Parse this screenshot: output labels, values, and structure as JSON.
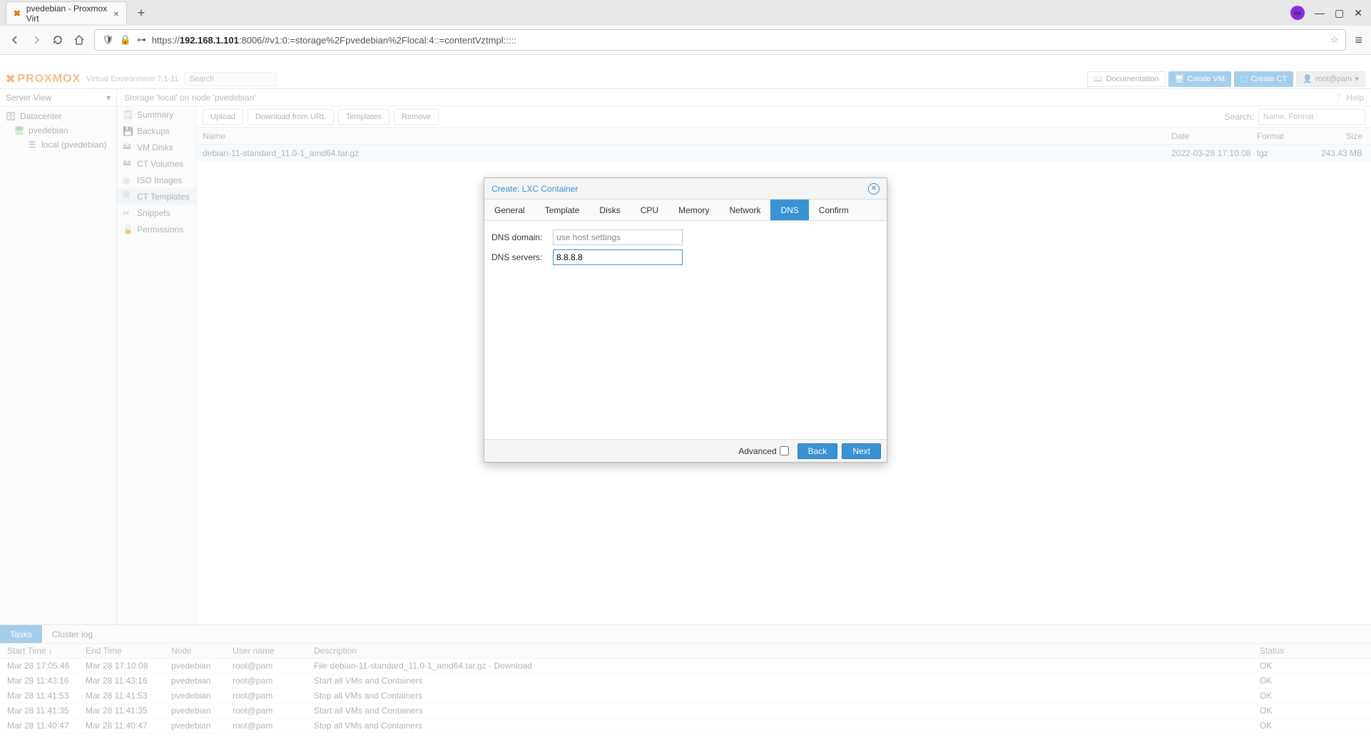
{
  "browser": {
    "tab_title": "pvedebian - Proxmox Virt",
    "url_prefix": "https://",
    "url_host": "192.168.1.101",
    "url_rest": ":8006/#v1:0:=storage%2Fpvedebian%2Flocal:4::=contentVztmpl:::::"
  },
  "header": {
    "logo": "PROXMOX",
    "version": "Virtual Environment 7.1-11",
    "search_placeholder": "Search",
    "doc": "Documentation",
    "create_vm": "Create VM",
    "create_ct": "Create CT",
    "user": "root@pam"
  },
  "tree": {
    "title": "Server View",
    "datacenter": "Datacenter",
    "node": "pvedebian",
    "storage": "local (pvedebian)"
  },
  "crumb": "Storage 'local' on node 'pvedebian'",
  "help": "Help",
  "sidenav": {
    "summary": "Summary",
    "backups": "Backups",
    "vmdisks": "VM Disks",
    "ctvols": "CT Volumes",
    "iso": "ISO Images",
    "cttmpl": "CT Templates",
    "snippets": "Snippets",
    "perms": "Permissions"
  },
  "toolbar": {
    "upload": "Upload",
    "download": "Download from URL",
    "templates": "Templates",
    "remove": "Remove",
    "search_label": "Search:",
    "search_placeholder": "Name, Format"
  },
  "grid": {
    "cols": {
      "name": "Name",
      "date": "Date",
      "format": "Format",
      "size": "Size"
    },
    "rows": [
      {
        "name": "debian-11-standard_11.0-1_amd64.tar.gz",
        "date": "2022-03-28 17:10:08",
        "format": "tgz",
        "size": "243.43 MB"
      }
    ]
  },
  "tasks": {
    "tab_tasks": "Tasks",
    "tab_cluster": "Cluster log",
    "cols": {
      "start": "Start Time",
      "end": "End Time",
      "node": "Node",
      "user": "User name",
      "desc": "Description",
      "status": "Status"
    },
    "rows": [
      {
        "start": "Mar 28 17:05:46",
        "end": "Mar 28 17:10:08",
        "node": "pvedebian",
        "user": "root@pam",
        "desc": "File debian-11-standard_11.0-1_amd64.tar.gz - Download",
        "status": "OK"
      },
      {
        "start": "Mar 28 11:43:16",
        "end": "Mar 28 11:43:16",
        "node": "pvedebian",
        "user": "root@pam",
        "desc": "Start all VMs and Containers",
        "status": "OK"
      },
      {
        "start": "Mar 28 11:41:53",
        "end": "Mar 28 11:41:53",
        "node": "pvedebian",
        "user": "root@pam",
        "desc": "Stop all VMs and Containers",
        "status": "OK"
      },
      {
        "start": "Mar 28 11:41:35",
        "end": "Mar 28 11:41:35",
        "node": "pvedebian",
        "user": "root@pam",
        "desc": "Start all VMs and Containers",
        "status": "OK"
      },
      {
        "start": "Mar 28 11:40:47",
        "end": "Mar 28 11:40:47",
        "node": "pvedebian",
        "user": "root@pam",
        "desc": "Stop all VMs and Containers",
        "status": "OK"
      }
    ]
  },
  "dialog": {
    "title": "Create: LXC Container",
    "tabs": [
      "General",
      "Template",
      "Disks",
      "CPU",
      "Memory",
      "Network",
      "DNS",
      "Confirm"
    ],
    "active_tab": "DNS",
    "dns_domain_label": "DNS domain:",
    "dns_domain_placeholder": "use host settings",
    "dns_servers_label": "DNS servers:",
    "dns_servers_value": "8.8.8.8",
    "advanced": "Advanced",
    "back": "Back",
    "next": "Next"
  }
}
